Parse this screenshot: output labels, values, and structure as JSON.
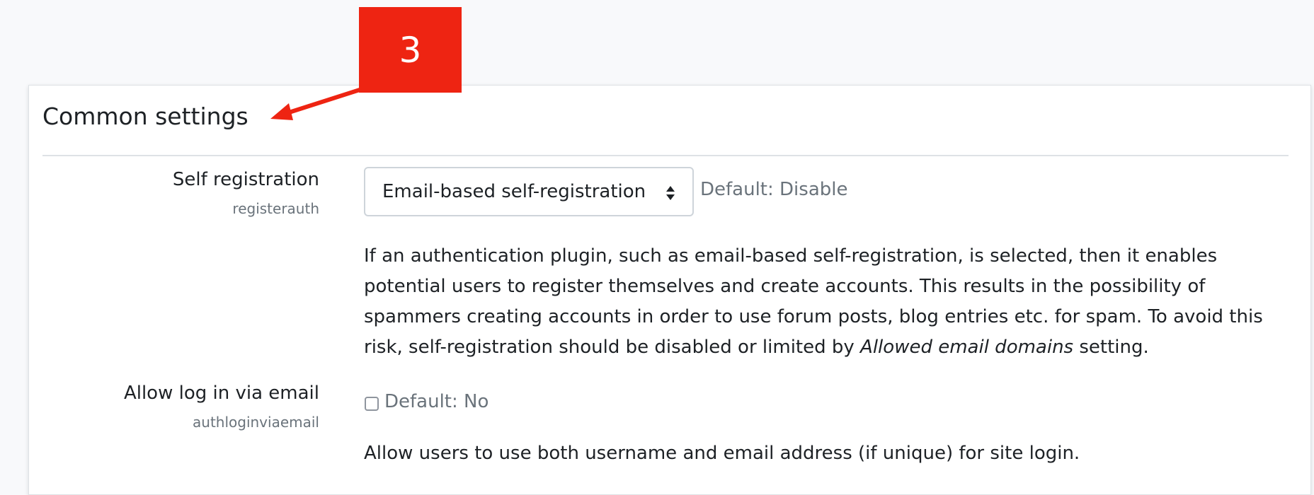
{
  "callout": {
    "number": "3",
    "color": "#ee2412"
  },
  "section": {
    "title": "Common settings"
  },
  "settings": [
    {
      "label": "Self registration",
      "key": "registerauth",
      "control": "select",
      "selected": "Email-based self-registration",
      "default": "Default: Disable",
      "description_parts": [
        "If an authentication plugin, such as email-based self-registration, is selected, then it enables potential users to register themselves and create accounts. This results in the possibility of spammers creating accounts in order to use forum posts, blog entries etc. for spam. To avoid this risk, self-registration should be disabled or limited by ",
        "Allowed email domains",
        " setting."
      ]
    },
    {
      "label": "Allow log in via email",
      "key": "authloginviaemail",
      "control": "checkbox",
      "checked": false,
      "default": "Default: No",
      "description": "Allow users to use both username and email address (if unique) for site login."
    }
  ]
}
